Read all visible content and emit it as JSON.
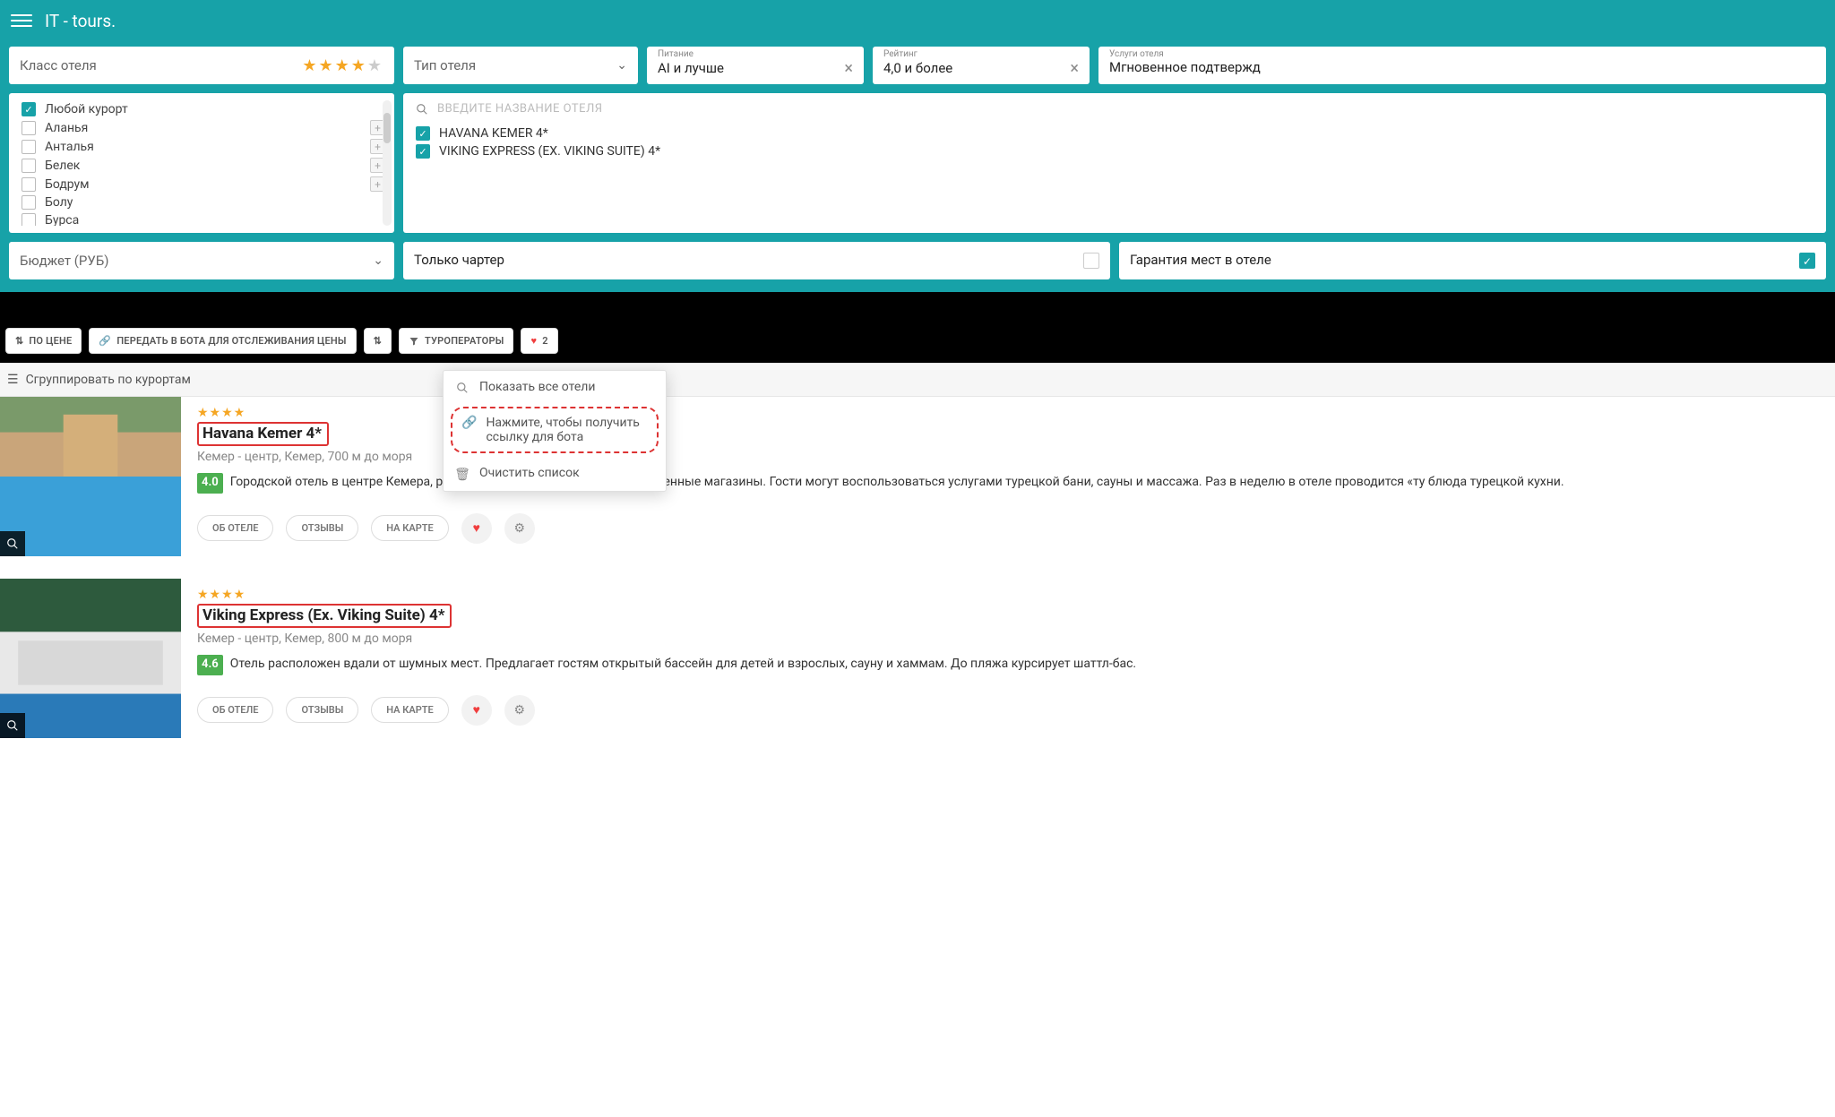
{
  "header": {
    "title": "IT - tours."
  },
  "filters": {
    "hotelClass": {
      "label": "Класс отеля",
      "stars": 4
    },
    "hotelType": {
      "label": "Тип отеля"
    },
    "food": {
      "smallLabel": "Питание",
      "value": "AI и лучше"
    },
    "rating": {
      "smallLabel": "Рейтинг",
      "value": "4,0 и более"
    },
    "services": {
      "smallLabel": "Услуги отеля",
      "value": "Мгновенное подтвержд"
    }
  },
  "resorts": {
    "anyLabel": "Любой курорт",
    "items": [
      "Аланья",
      "Анталья",
      "Белек",
      "Бодрум",
      "Болу",
      "Бурса"
    ]
  },
  "hotelSearch": {
    "placeholder": "ВВЕДИТЕ НАЗВАНИЕ ОТЕЛЯ",
    "selected": [
      "HAVANA KEMER 4*",
      "VIKING EXPRESS (EX. VIKING SUITE) 4*"
    ]
  },
  "row3": {
    "budget": "Бюджет (РУБ)",
    "charter": "Только чартер",
    "guarantee": "Гарантия мест в отеле"
  },
  "toolbar": {
    "byPrice": "ПО ЦЕНЕ",
    "sendToBot": "ПЕРЕДАТЬ В БОТА ДЛЯ ОТСЛЕЖИВАНИЯ ЦЕНЫ",
    "operators": "ТУРОПЕРАТОРЫ",
    "favCount": "2"
  },
  "groupLabel": "Сгруппировать по курортам",
  "dropdown": {
    "showAll": "Показать все отели",
    "getLink": "Нажмите, чтобы получить ссылку для бота",
    "clear": "Очистить список"
  },
  "hotels": [
    {
      "name": "Havana Kemer 4*",
      "stars": 4,
      "location": "Кемер - центр, Кемер, 700 м до моря",
      "rating": "4.0",
      "desc": "Городской отель в центре Кемера, рядом работают кафе и продовольственные магазины. Гости могут воспользоваться услугами турецкой бани, сауны и массажа. Раз в неделю в отеле проводится «ту блюда турецкой кухни."
    },
    {
      "name": "Viking Express (Ex. Viking Suite) 4*",
      "stars": 4,
      "location": "Кемер - центр, Кемер, 800 м до моря",
      "rating": "4.6",
      "desc": "Отель расположен вдали от шумных мест. Предлагает гостям открытый бассейн для детей и взрослых, сауну и хаммам. До пляжа курсирует шаттл-бас."
    }
  ],
  "actions": {
    "about": "ОБ ОТЕЛЕ",
    "reviews": "ОТЗЫВЫ",
    "onMap": "НА КАРТЕ"
  }
}
